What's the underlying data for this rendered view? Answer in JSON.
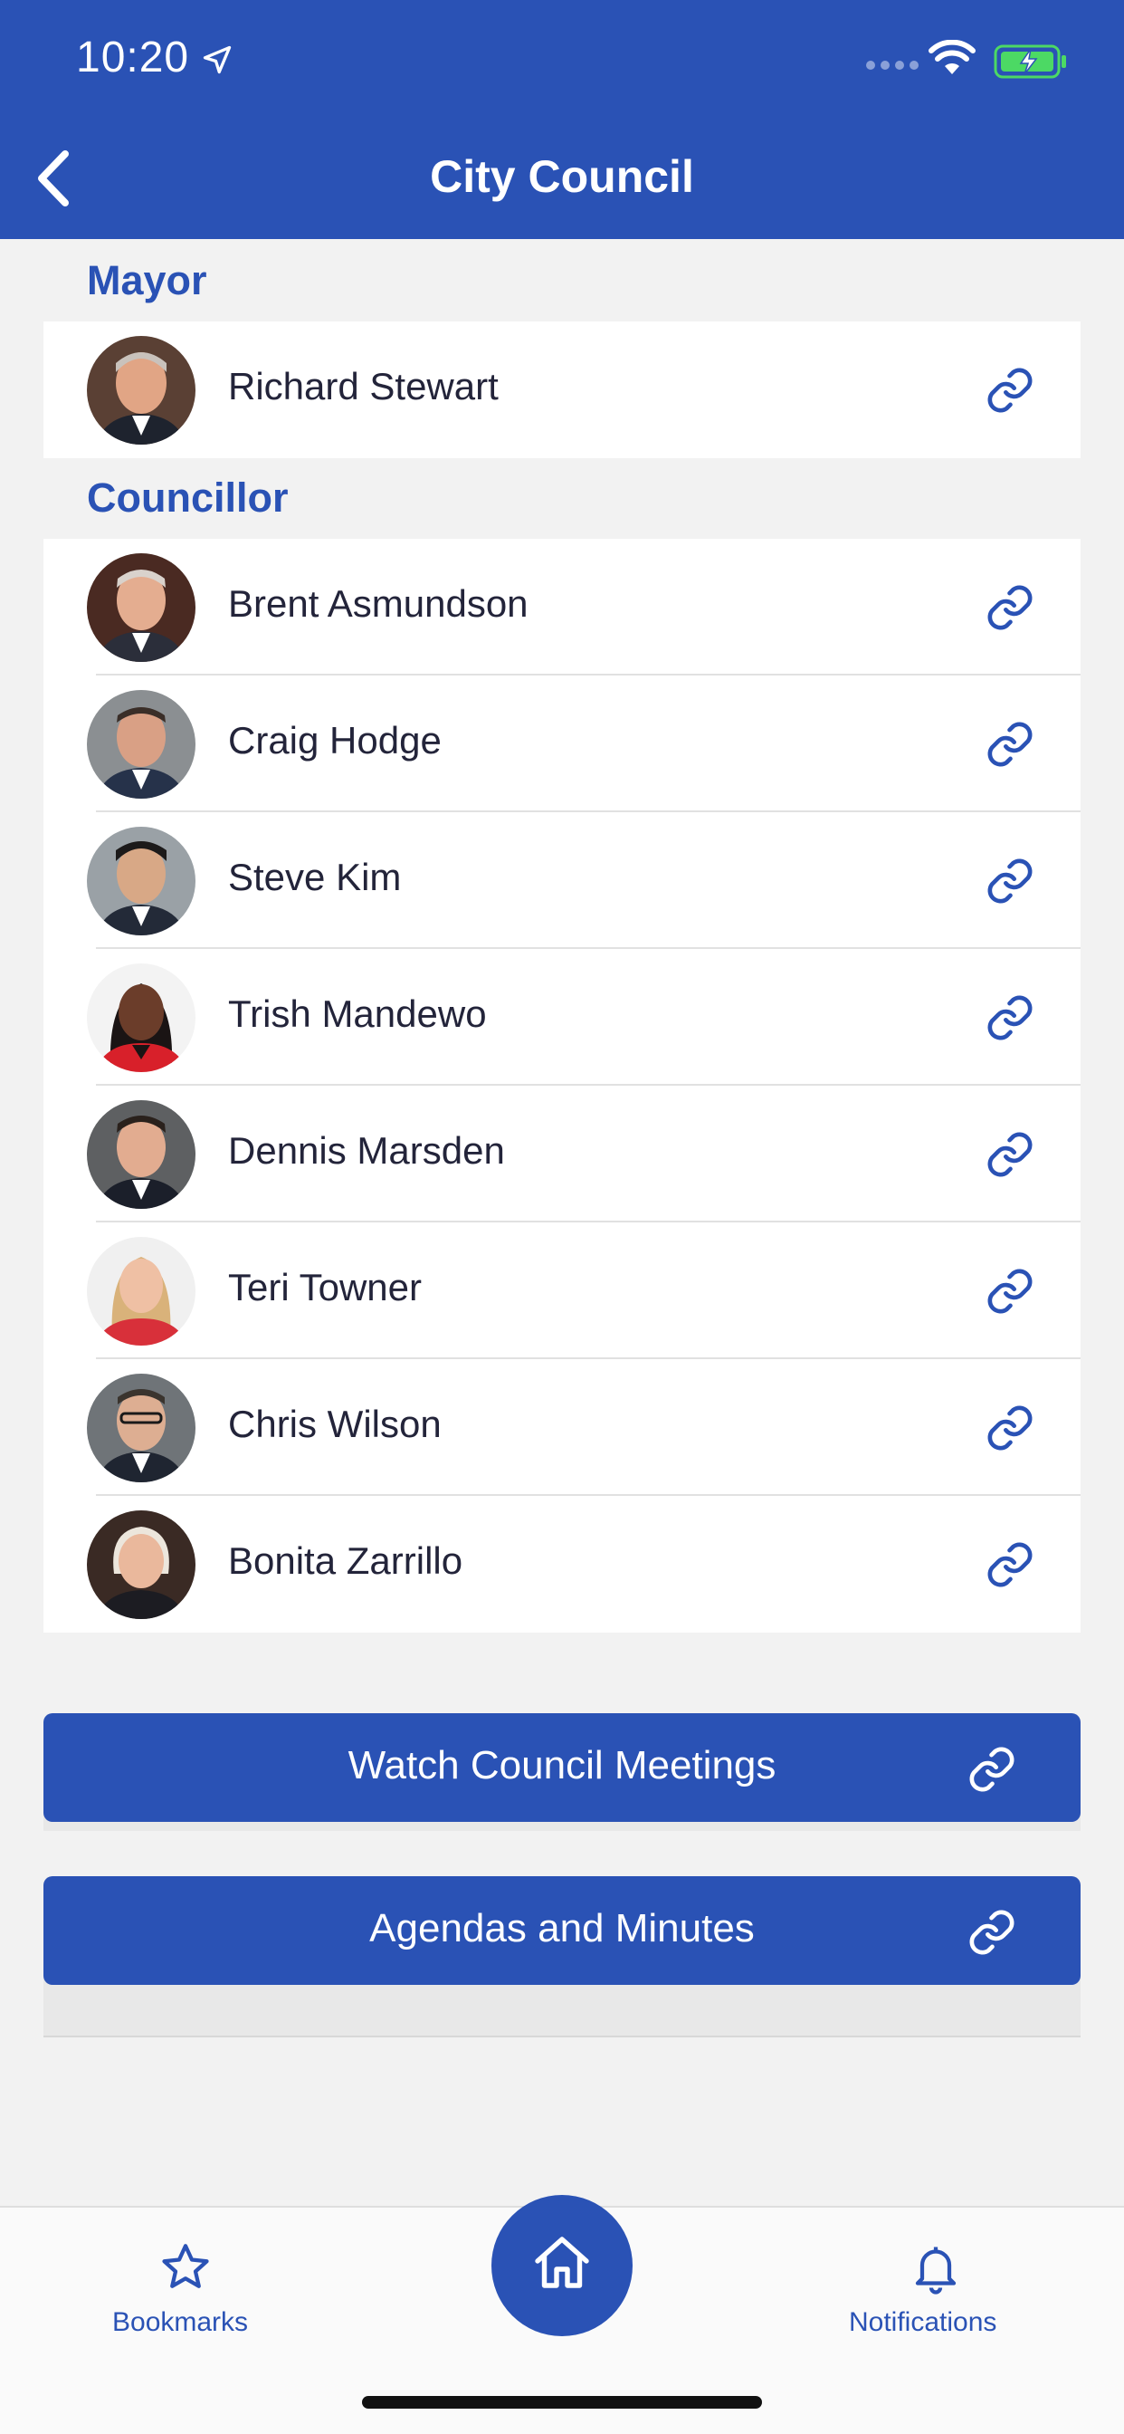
{
  "status_bar": {
    "time": "10:20"
  },
  "nav": {
    "title": "City Council"
  },
  "sections": {
    "mayor_label": "Mayor",
    "councillor_label": "Councillor"
  },
  "mayor": {
    "name": "Richard Stewart"
  },
  "councillors": [
    {
      "name": "Brent Asmundson"
    },
    {
      "name": "Craig Hodge"
    },
    {
      "name": "Steve Kim"
    },
    {
      "name": "Trish Mandewo"
    },
    {
      "name": "Dennis Marsden"
    },
    {
      "name": "Teri Towner"
    },
    {
      "name": "Chris Wilson"
    },
    {
      "name": "Bonita Zarrillo"
    }
  ],
  "buttons": {
    "watch": "Watch Council Meetings",
    "agendas": "Agendas and Minutes"
  },
  "tabbar": {
    "bookmarks": "Bookmarks",
    "notifications": "Notifications"
  },
  "colors": {
    "brand_blue": "#2a52b5",
    "battery_green": "#4cd964"
  },
  "icons": [
    "back-chevron-icon",
    "link-icon",
    "star-icon",
    "home-icon",
    "bell-icon",
    "wifi-icon",
    "battery-icon",
    "location-arrow-icon"
  ]
}
